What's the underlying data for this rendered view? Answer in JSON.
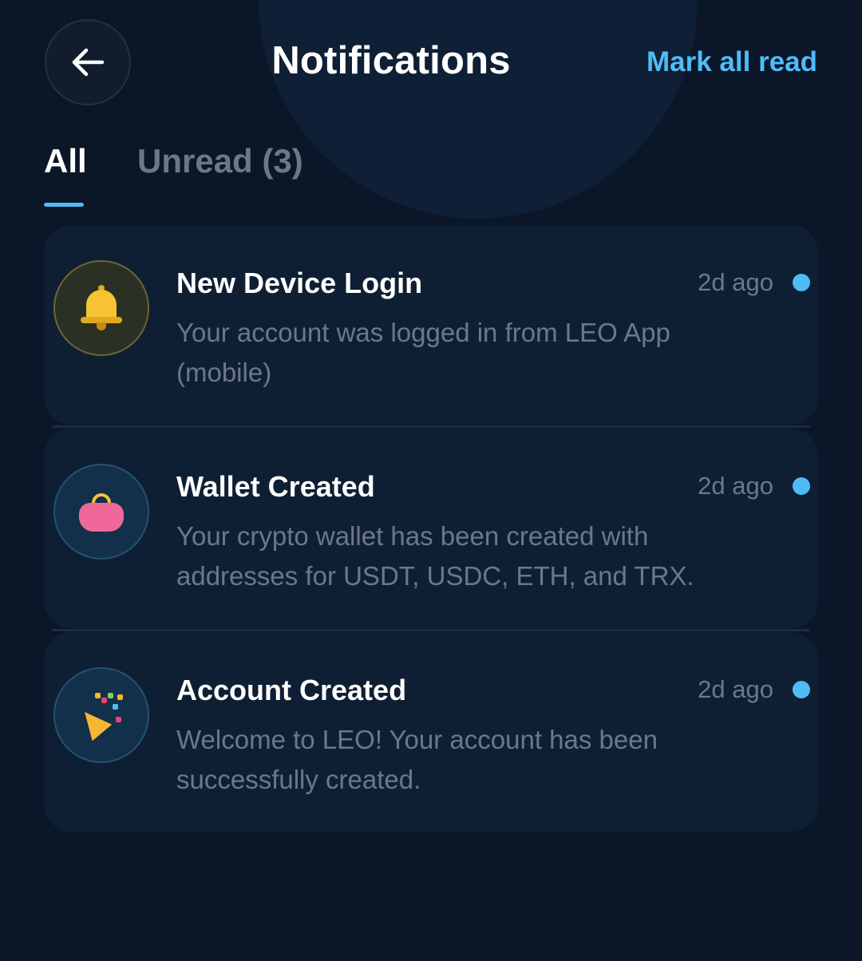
{
  "header": {
    "title": "Notifications",
    "mark_all_read": "Mark all read",
    "back_icon": "arrow-left-icon"
  },
  "tabs": [
    {
      "label": "All",
      "active": true
    },
    {
      "label": "Unread (3)",
      "active": false
    }
  ],
  "notifications": [
    {
      "title": "New Device Login",
      "time": "2d ago",
      "body": "Your account was logged in from LEO App (mobile)",
      "icon": "bell-icon",
      "unread": true
    },
    {
      "title": "Wallet Created",
      "time": "2d ago",
      "body": "Your crypto wallet has been created with addresses for USDT, USDC, ETH, and TRX.",
      "icon": "purse-icon",
      "unread": true
    },
    {
      "title": "Account Created",
      "time": "2d ago",
      "body": "Welcome to LEO! Your account has been successfully created.",
      "icon": "party-popper-icon",
      "unread": true
    }
  ],
  "colors": {
    "background": "#0b1628",
    "card": "#0f1f33",
    "accent": "#4fbcf5",
    "muted_text": "#6c7888"
  }
}
